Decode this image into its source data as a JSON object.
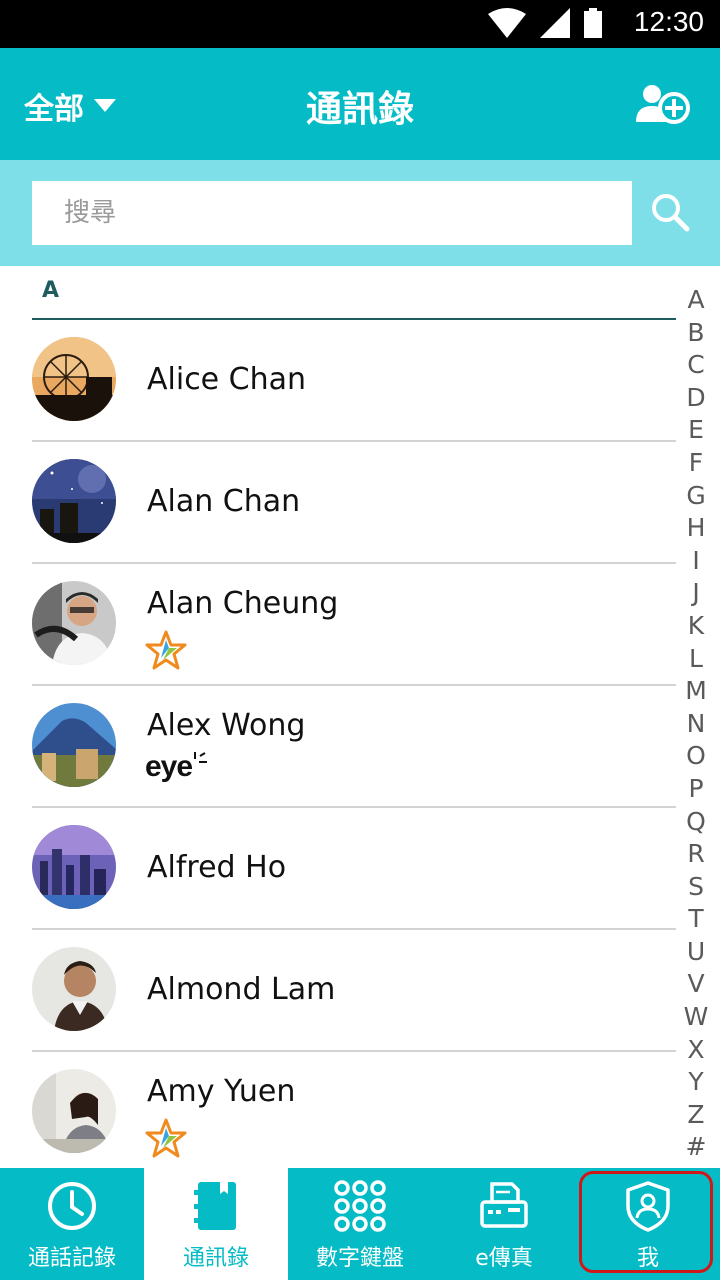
{
  "status_bar": {
    "time": "12:30"
  },
  "app_bar": {
    "filter_label": "全部",
    "title": "通訊錄"
  },
  "search": {
    "placeholder": "搜尋"
  },
  "section": {
    "letter": "A"
  },
  "contacts": [
    {
      "name": "Alice Chan",
      "badge": ""
    },
    {
      "name": "Alan Chan",
      "badge": ""
    },
    {
      "name": "Alan Cheung",
      "badge": "star-icon"
    },
    {
      "name": "Alex Wong",
      "badge": "eye",
      "badge_text": "eye"
    },
    {
      "name": "Alfred Ho",
      "badge": ""
    },
    {
      "name": "Almond Lam",
      "badge": ""
    },
    {
      "name": "Amy Yuen",
      "badge": "star-icon"
    }
  ],
  "index_letters": [
    "A",
    "B",
    "C",
    "D",
    "E",
    "F",
    "G",
    "H",
    "I",
    "J",
    "K",
    "L",
    "M",
    "N",
    "O",
    "P",
    "Q",
    "R",
    "S",
    "T",
    "U",
    "V",
    "W",
    "X",
    "Y",
    "Z",
    "#"
  ],
  "bottom_nav": [
    {
      "label": "通話記錄",
      "icon": "clock-icon"
    },
    {
      "label": "通訊錄",
      "icon": "contacts-book-icon",
      "active": true
    },
    {
      "label": "數字鍵盤",
      "icon": "dialpad-icon"
    },
    {
      "label": "e傳真",
      "icon": "fax-icon"
    },
    {
      "label": "我",
      "icon": "profile-shield-icon"
    }
  ],
  "colors": {
    "primary": "#05bcc6",
    "search_bg": "#7fdfe8",
    "highlight": "#d01818"
  }
}
